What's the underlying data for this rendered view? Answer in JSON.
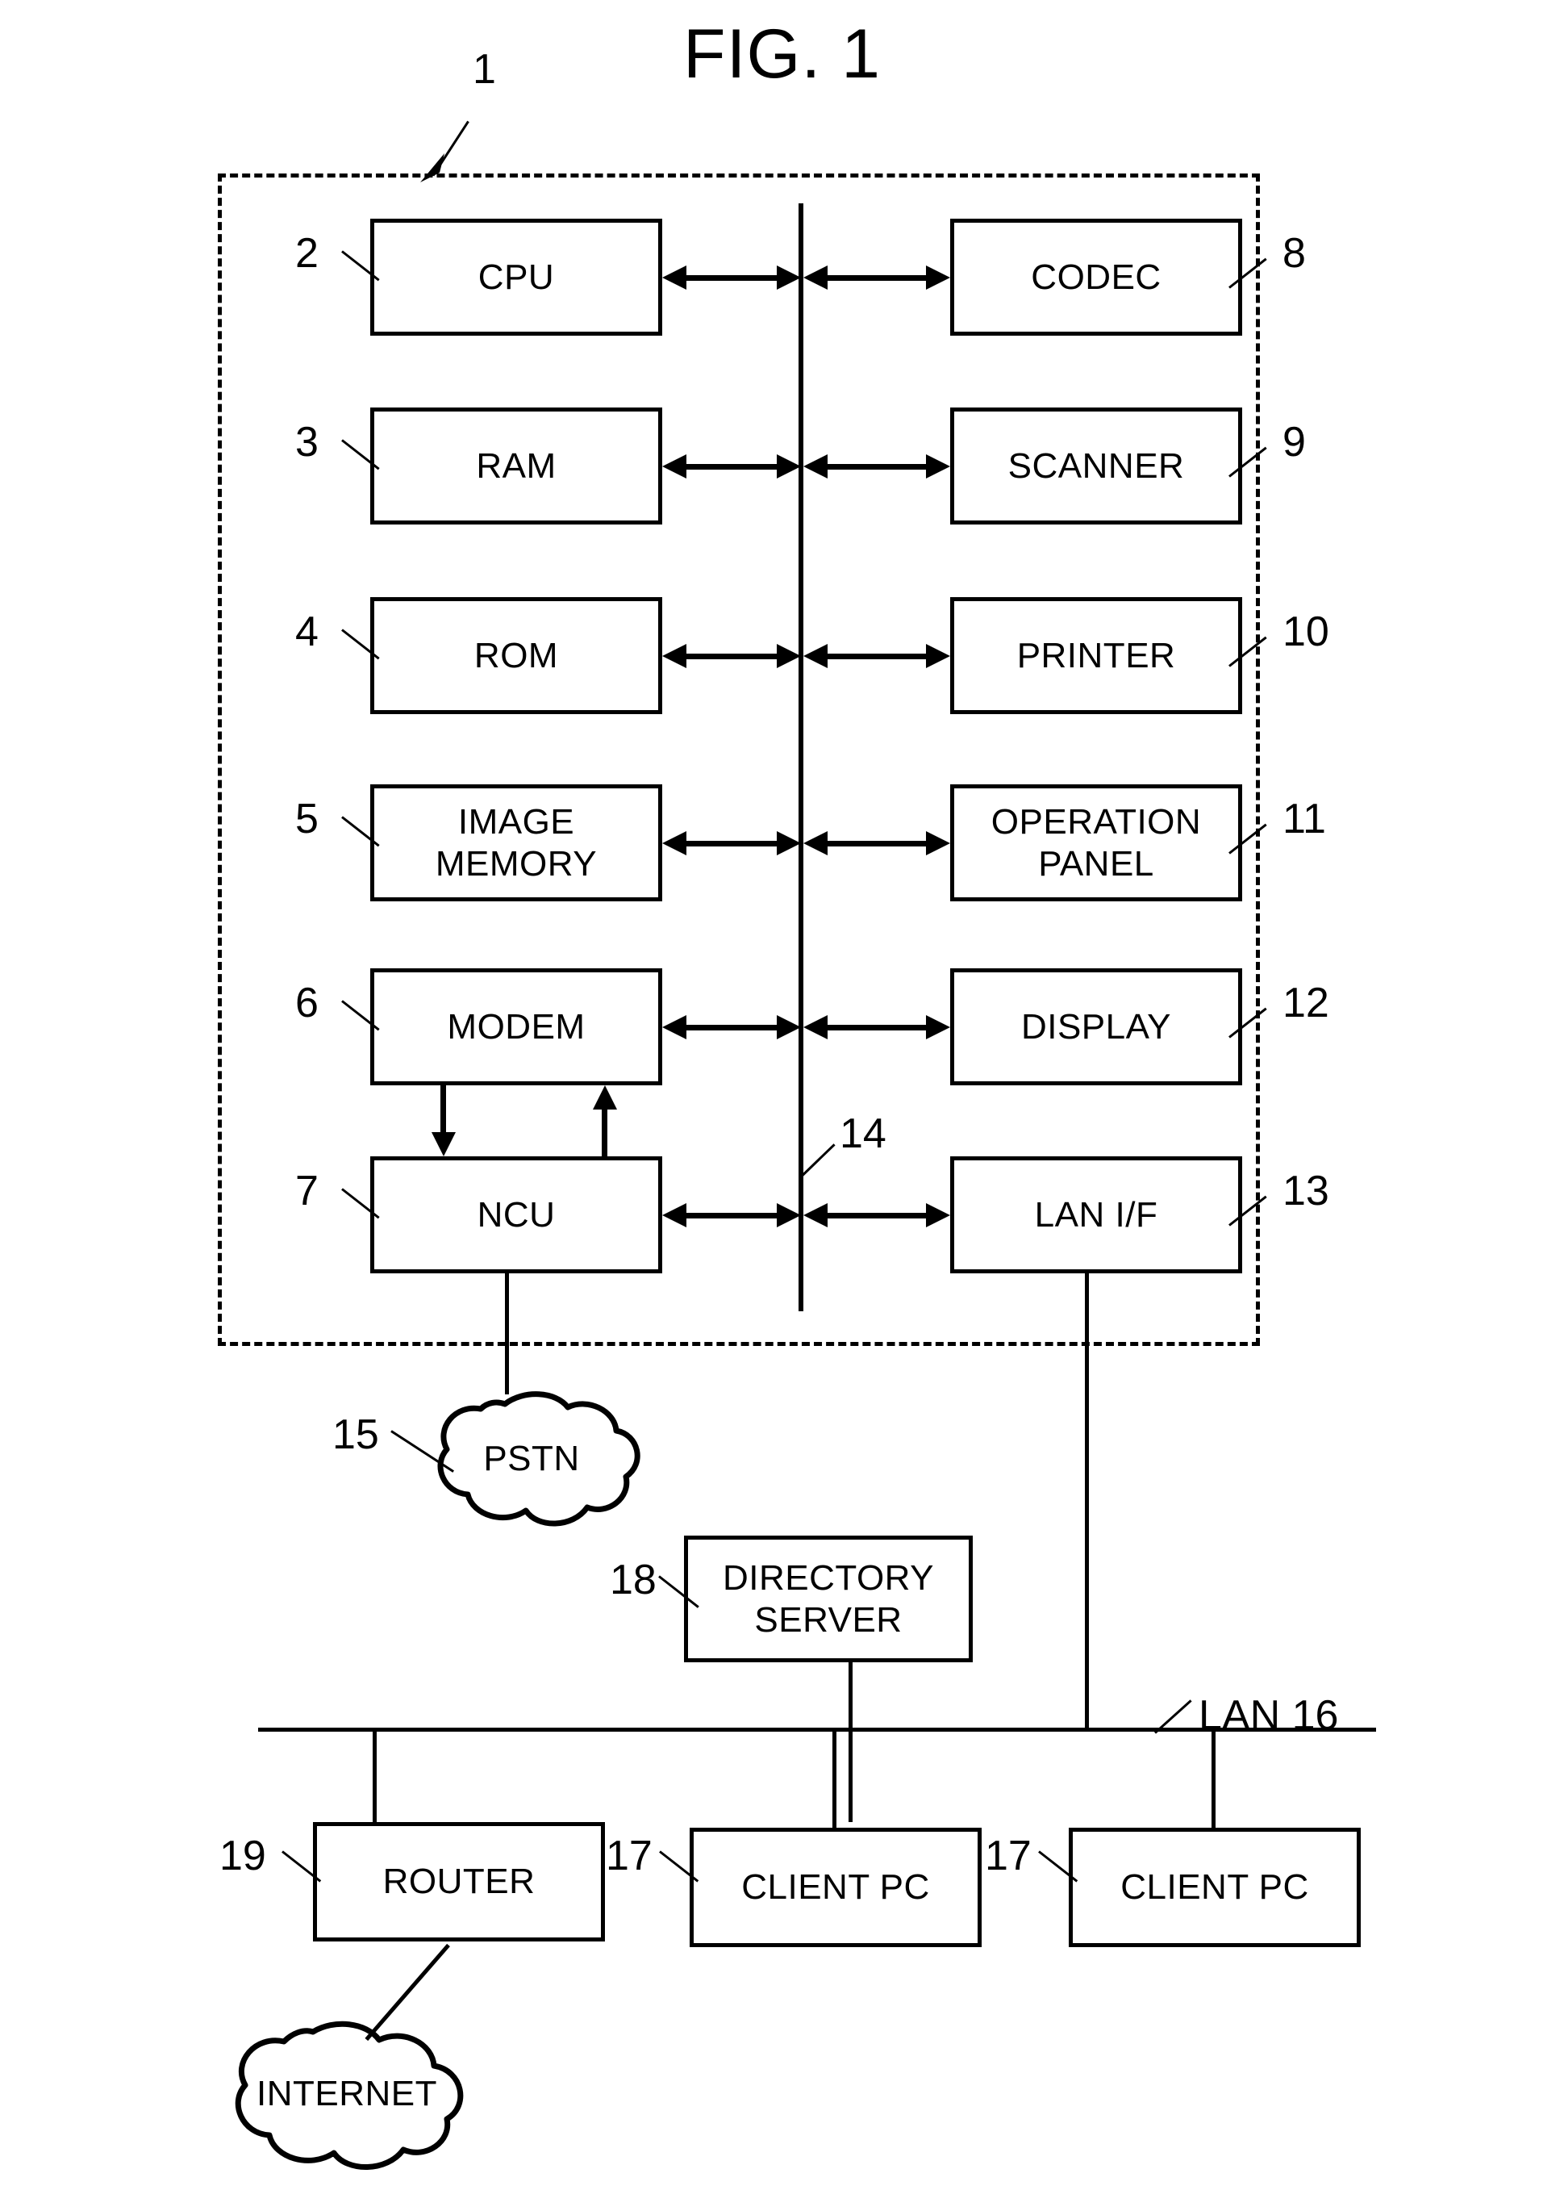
{
  "figure": {
    "title": "FIG. 1",
    "enclosure_ref": "1",
    "bus_ref": "14",
    "lan_label": "LAN 16"
  },
  "left_column": [
    {
      "ref": "2",
      "label": "CPU"
    },
    {
      "ref": "3",
      "label": "RAM"
    },
    {
      "ref": "4",
      "label": "ROM"
    },
    {
      "ref": "5",
      "label": "IMAGE\nMEMORY",
      "line1": "IMAGE",
      "line2": "MEMORY"
    },
    {
      "ref": "6",
      "label": "MODEM"
    },
    {
      "ref": "7",
      "label": "NCU"
    }
  ],
  "right_column": [
    {
      "ref": "8",
      "label": "CODEC"
    },
    {
      "ref": "9",
      "label": "SCANNER"
    },
    {
      "ref": "10",
      "label": "PRINTER"
    },
    {
      "ref": "11",
      "label": "OPERATION\nPANEL",
      "line1": "OPERATION",
      "line2": "PANEL"
    },
    {
      "ref": "12",
      "label": "DISPLAY"
    },
    {
      "ref": "13",
      "label": "LAN I/F"
    }
  ],
  "network": {
    "pstn": {
      "ref": "15",
      "label": "PSTN"
    },
    "internet": {
      "label": "INTERNET"
    },
    "directory_server": {
      "ref": "18",
      "line1": "DIRECTORY",
      "line2": "SERVER"
    },
    "router": {
      "ref": "19",
      "label": "ROUTER"
    },
    "client_pc_left": {
      "ref": "17",
      "label": "CLIENT PC"
    },
    "client_pc_right": {
      "ref": "17",
      "label": "CLIENT PC"
    }
  },
  "colors": {
    "ink": "#000000",
    "paper": "#ffffff"
  }
}
